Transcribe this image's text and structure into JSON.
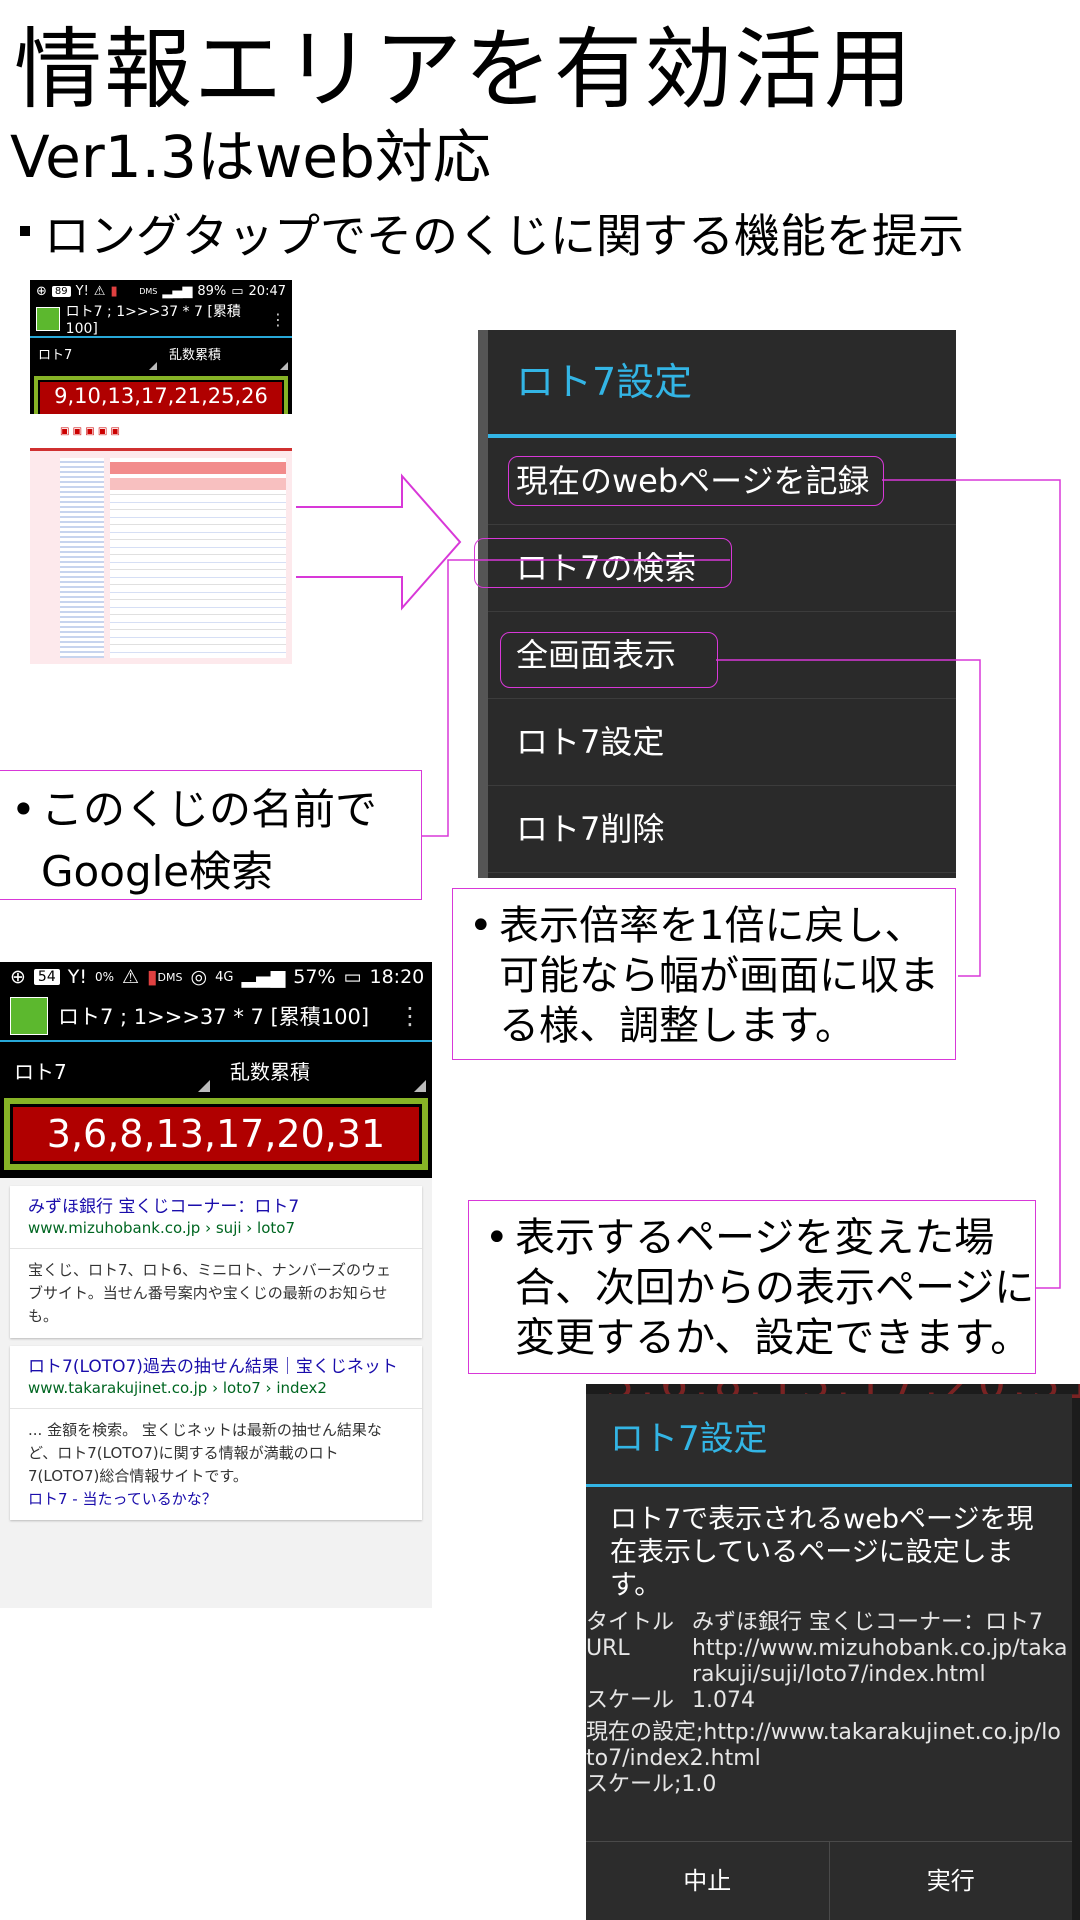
{
  "header": {
    "title": "情報エリアを有効活用",
    "subtitle": "Ver1.3はweb対応",
    "feature": "ロングタップでそのくじに関する機能を提示"
  },
  "phone_small": {
    "status": {
      "left": "89",
      "battery": "89%",
      "time": "20:47",
      "dms": "DMS"
    },
    "app_title": "ロト7 ; 1>>>37 * 7 [累積100]",
    "spinner_left": "ロト7",
    "spinner_right": "乱数累積",
    "numbers": "9,10,13,17,21,25,26"
  },
  "dialog_menu": {
    "title": "ロト7設定",
    "items": [
      "現在のwebページを記録",
      "ロト7の検索",
      "全画面表示",
      "ロト7設定",
      "ロト7削除"
    ]
  },
  "callouts": {
    "search": [
      "このくじの名前で",
      "Google検索"
    ],
    "zoom": "表示倍率を1倍に戻し、可能なら幅が画面に収まる様、調整します。",
    "page": "表示するページを変えた場合、次回からの表示ページに変更するか、設定できます。"
  },
  "phone_big": {
    "status": {
      "chip": "54",
      "y": "Y!",
      "percent": "0%",
      "dms": "DMS",
      "net": "4G",
      "battery": "57%",
      "time": "18:20"
    },
    "app_title": "ロト7 ; 1>>>37 * 7 [累積100]",
    "spinner_left": "ロト7",
    "spinner_right": "乱数累積",
    "numbers": "3,6,8,13,17,20,31",
    "results": [
      {
        "title": "みずほ銀行 宝くじコーナー：ロト7",
        "url": "www.mizuhobank.co.jp › suji › loto7",
        "snippet": "宝くじ、ロト7、ロト6、ミニロト、ナンバーズのウェブサイト。当せん番号案内や宝くじの最新のお知らせも。"
      },
      {
        "title": "ロト7(LOTO7)過去の抽せん結果｜宝くじネット",
        "url": "www.takarakujinet.co.jp › loto7 › index2",
        "snippet": "... 金額を検索。 宝くじネットは最新の抽せん結果など、ロト7(LOTO7)に関する情報が満載のロト7(LOTO7)総合情報サイトです。",
        "sublink": "ロト7 - 当たっているかな？"
      }
    ]
  },
  "dialog_confirm": {
    "bg_numbers": "3,6,8,13,17,20,31",
    "title": "ロト7設定",
    "message": "ロト7で表示されるwebページを現在表示しているページに設定します。",
    "title_label": "タイトル",
    "title_value": "みずほ銀行 宝くじコーナー：ロト7",
    "url_label": "URL",
    "url_value": "http://www.mizuhobank.co.jp/takarakuji/suji/loto7/index.html",
    "scale_label": "スケール",
    "scale_value": "1.074",
    "current_setting": "現在の設定;http://www.takarakujinet.co.jp/loto7/index2.html",
    "current_scale": "スケール;1.0",
    "cancel": "中止",
    "execute": "実行"
  },
  "colors": {
    "accent": "#33b5e5",
    "highlight": "#d838d8",
    "number_bg": "#b00000",
    "number_frame": "#86b326"
  }
}
